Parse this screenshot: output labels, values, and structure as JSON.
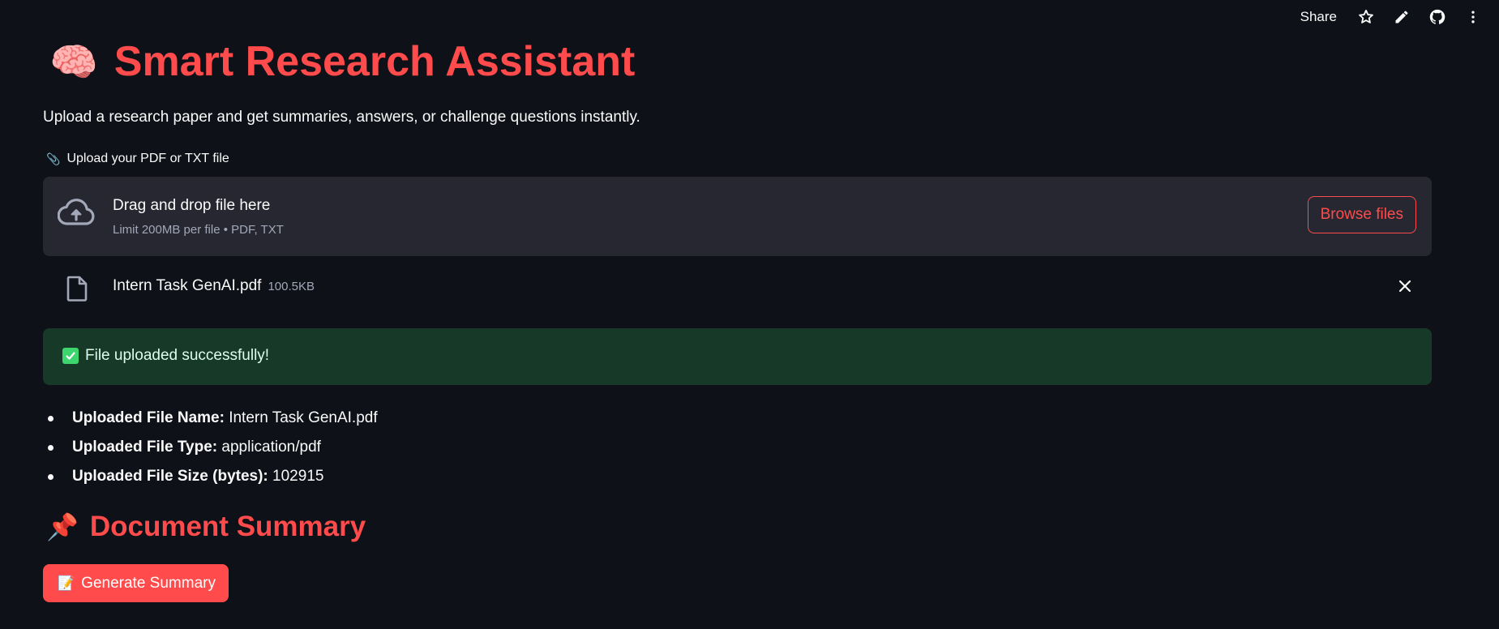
{
  "header": {
    "share_label": "Share",
    "icons": [
      "star-icon",
      "edit-pencil-icon",
      "github-icon",
      "more-vertical-icon"
    ]
  },
  "page": {
    "title_emoji": "🧠",
    "title": "Smart Research Assistant",
    "subtitle": "Upload a research paper and get summaries, answers, or challenge questions instantly."
  },
  "uploader": {
    "label_icon": "📎",
    "label": "Upload your PDF or TXT file",
    "drag_text": "Drag and drop file here",
    "limit_text": "Limit 200MB per file • PDF, TXT",
    "browse_label": "Browse files",
    "file_name": "Intern Task GenAI.pdf",
    "file_size": "100.5KB"
  },
  "alert": {
    "icon": "check-box-icon",
    "message": "File uploaded successfully!",
    "color": "#173928"
  },
  "file_info": [
    {
      "label": "Uploaded File Name:",
      "value": "Intern Task GenAI.pdf"
    },
    {
      "label": "Uploaded File Type:",
      "value": "application/pdf"
    },
    {
      "label": "Uploaded File Size (bytes):",
      "value": "102915"
    }
  ],
  "summary": {
    "emoji": "📌",
    "heading": "Document Summary",
    "button_icon": "📝",
    "button_label": "Generate Summary"
  },
  "colors": {
    "background": "#0e1117",
    "accent": "#ff4b4b",
    "panel": "#262730",
    "success_bg": "#173928"
  }
}
